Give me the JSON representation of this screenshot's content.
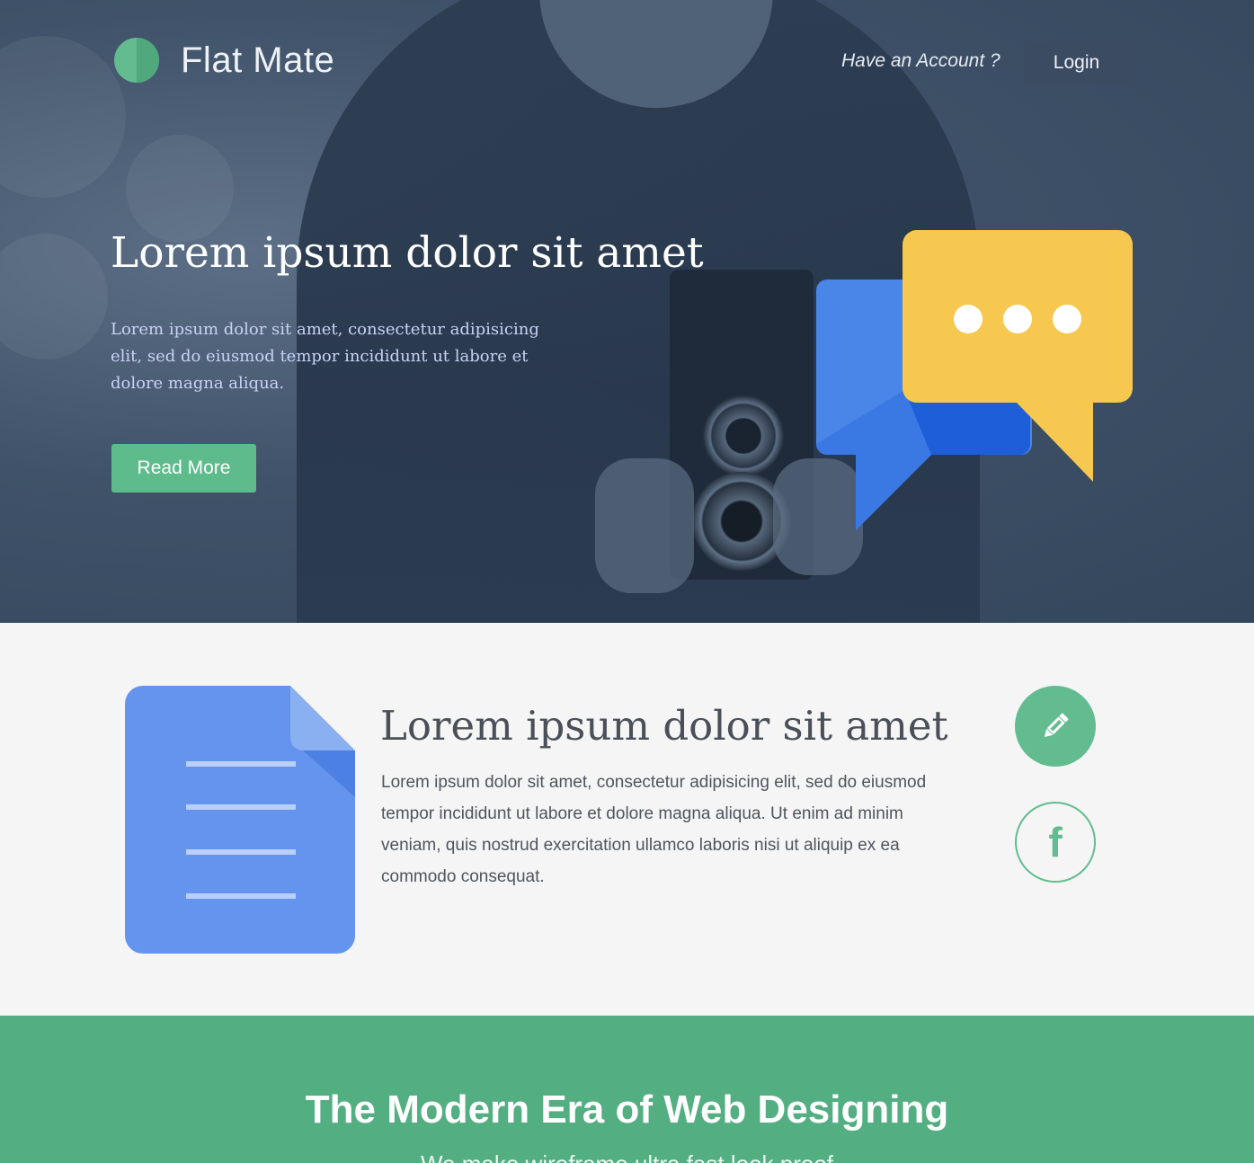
{
  "header": {
    "brand_name": "Flat Mate",
    "account_question": "Have an Account ?",
    "login_label": "Login"
  },
  "hero": {
    "title": "Lorem ipsum dolor sit amet",
    "text": "Lorem ipsum dolor sit amet, consectetur adipisicing elit, sed do eiusmod tempor incididunt ut labore et dolore magna aliqua.",
    "read_more_label": "Read More"
  },
  "feature": {
    "title": "Lorem ipsum dolor sit amet",
    "text": "Lorem ipsum dolor sit amet, consectetur adipisicing elit, sed do eiusmod tempor incididunt ut labore et dolore magna aliqua. Ut enim ad minim veniam, quis nostrud exercitation ullamco laboris nisi ut aliquip ex ea commodo consequat.",
    "facebook_glyph": "f"
  },
  "banner": {
    "title": "The Modern Era of Web Designing",
    "subtitle": "We make wireframe ultra fast look proof"
  },
  "icons": {
    "logo": "logo-icon",
    "chat": "chat-bubbles-icon",
    "document": "document-icon",
    "edit": "pencil-icon",
    "facebook": "facebook-icon"
  },
  "colors": {
    "accent_green": "#5dbb8c",
    "banner_green": "#53ae82",
    "hero_navy": "#3f5269",
    "login_button": "#3b4b62",
    "chat_yellow": "#f6c850",
    "chat_blue": "#4a86e8",
    "doc_blue": "#6494ed"
  }
}
